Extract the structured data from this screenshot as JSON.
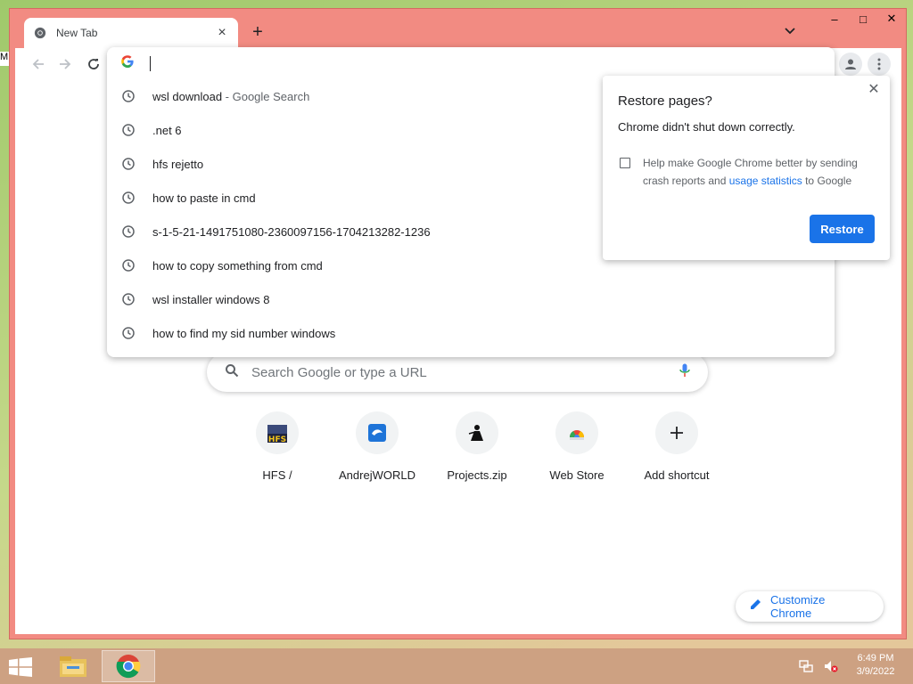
{
  "tab": {
    "title": "New Tab"
  },
  "new_tab_label": "+",
  "window_controls": {
    "minimize": "–",
    "maximize": "□",
    "close": "✕"
  },
  "omnibox": {
    "suggestions": [
      {
        "text": "wsl download",
        "desc": " - Google Search"
      },
      {
        "text": ".net 6",
        "desc": ""
      },
      {
        "text": "hfs rejetto",
        "desc": ""
      },
      {
        "text": "how to paste in cmd",
        "desc": ""
      },
      {
        "text": "s-1-5-21-1491751080-2360097156-1704213282-1236",
        "desc": ""
      },
      {
        "text": "how to copy something from cmd",
        "desc": ""
      },
      {
        "text": "wsl installer windows 8",
        "desc": ""
      },
      {
        "text": "how to find my sid number windows",
        "desc": ""
      }
    ]
  },
  "ntp": {
    "search_placeholder": "Search Google or type a URL",
    "shortcuts": [
      {
        "label": "HFS /",
        "icon": "hfs-icon"
      },
      {
        "label": "AndrejWORLD",
        "icon": "andrejworld-icon"
      },
      {
        "label": "Projects.zip",
        "icon": "projects-icon"
      },
      {
        "label": "Web Store",
        "icon": "web-store-icon"
      },
      {
        "label": "Add shortcut",
        "icon": "plus-icon"
      }
    ],
    "customize_label": "Customize Chrome"
  },
  "restore_dialog": {
    "title": "Restore pages?",
    "message": "Chrome didn't shut down correctly.",
    "help_text_before": "Help make Google Chrome better by sending crash reports and ",
    "help_link": "usage statistics",
    "help_text_after": " to Google",
    "restore_label": "Restore",
    "close_label": "✕"
  },
  "taskbar": {
    "time": "6:49 PM",
    "date": "3/9/2022"
  },
  "colors": {
    "window_frame": "#f28b82",
    "accent": "#1a73e8",
    "taskbar": "#cda082"
  }
}
